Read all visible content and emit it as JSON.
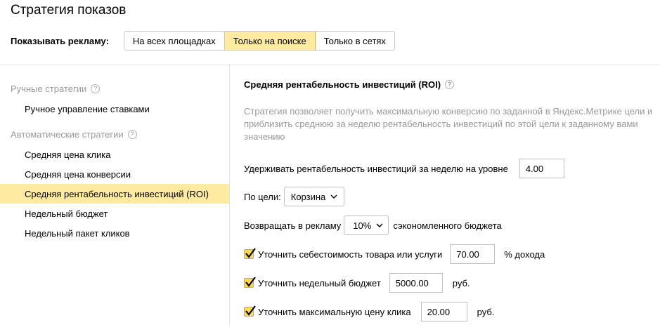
{
  "page": {
    "title": "Стратегия показов"
  },
  "show_ads": {
    "label": "Показывать рекламу:",
    "options": [
      {
        "label": "На всех площадках",
        "active": false
      },
      {
        "label": "Только на поиске",
        "active": true
      },
      {
        "label": "Только в сетях",
        "active": false
      }
    ]
  },
  "sidebar": {
    "manual_group": "Ручные стратегии",
    "manual_items": [
      "Ручное управление ставками"
    ],
    "auto_group": "Автоматические стратегии",
    "auto_items": [
      "Средняя цена клика",
      "Средняя цена конверсии",
      "Средняя рентабельность инвестиций (ROI)",
      "Недельный бюджет",
      "Недельный пакет кликов"
    ],
    "active_item": "Средняя рентабельность инвестиций (ROI)"
  },
  "main": {
    "title": "Средняя рентабельность инвестиций (ROI)",
    "description": "Стратегия позволяет получить максимальную конверсию по заданной в Яндекс.Метрике цели и приблизить среднюю за неделю рентабельность инвестиций по этой цели к заданному вами значению",
    "roi_label": "Удерживать рентабельность инвестиций за неделю на уровне",
    "roi_value": "4.00",
    "goal_label": "По цели:",
    "goal_value": "Корзина",
    "return_label": "Возвращать в рекламу",
    "return_value": "10%",
    "return_suffix": "сэкономленного бюджета",
    "cost_label": "Уточнить себестоимость товара или услуги",
    "cost_value": "70.00",
    "cost_suffix": "% дохода",
    "budget_label": "Уточнить недельный бюджет",
    "budget_value": "5000.00",
    "budget_suffix": "руб.",
    "maxcpc_label": "Уточнить максимальную цену клика",
    "maxcpc_value": "20.00",
    "maxcpc_suffix": "руб."
  },
  "icons": {
    "help": "question-circle-icon",
    "checkbox": "checkmark-icon",
    "dropdown": "chevron-down-icon"
  },
  "colors": {
    "accent": "#ffeba0",
    "checkbox": "#ffdb4d",
    "muted_text": "#999999"
  }
}
